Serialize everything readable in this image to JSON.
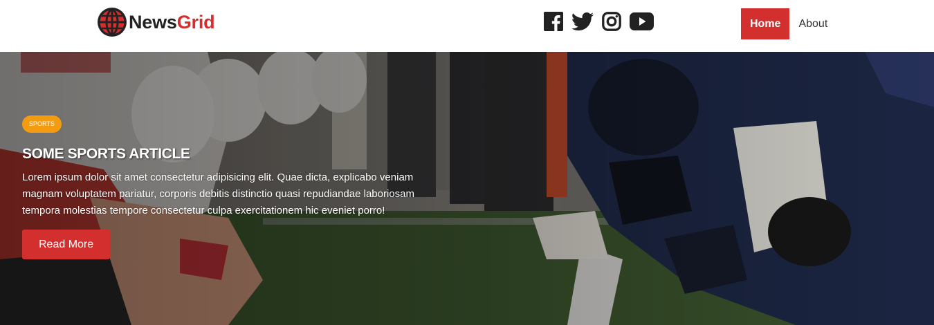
{
  "brand": {
    "name_part1": "News",
    "name_part2": "Grid",
    "accent": "#d32f2f",
    "icon": "globe-icon"
  },
  "social": [
    {
      "name": "facebook",
      "icon": "facebook-icon"
    },
    {
      "name": "twitter",
      "icon": "twitter-icon"
    },
    {
      "name": "instagram",
      "icon": "instagram-icon"
    },
    {
      "name": "youtube",
      "icon": "youtube-icon"
    }
  ],
  "nav": {
    "home": "Home",
    "about": "About"
  },
  "hero": {
    "category": "Sports",
    "category_color": "#f39c12",
    "title": "Some Sports Article",
    "text": "Lorem ipsum dolor sit amet consectetur adipisicing elit. Quae dicta, explicabo veniam magnam voluptatem pariatur, corporis debitis distinctio quasi repudiandae laboriosam tempora molestias tempore consectetur culpa exercitationem hic eveniet porro!",
    "button": "Read More",
    "button_color": "#d32f2f"
  }
}
